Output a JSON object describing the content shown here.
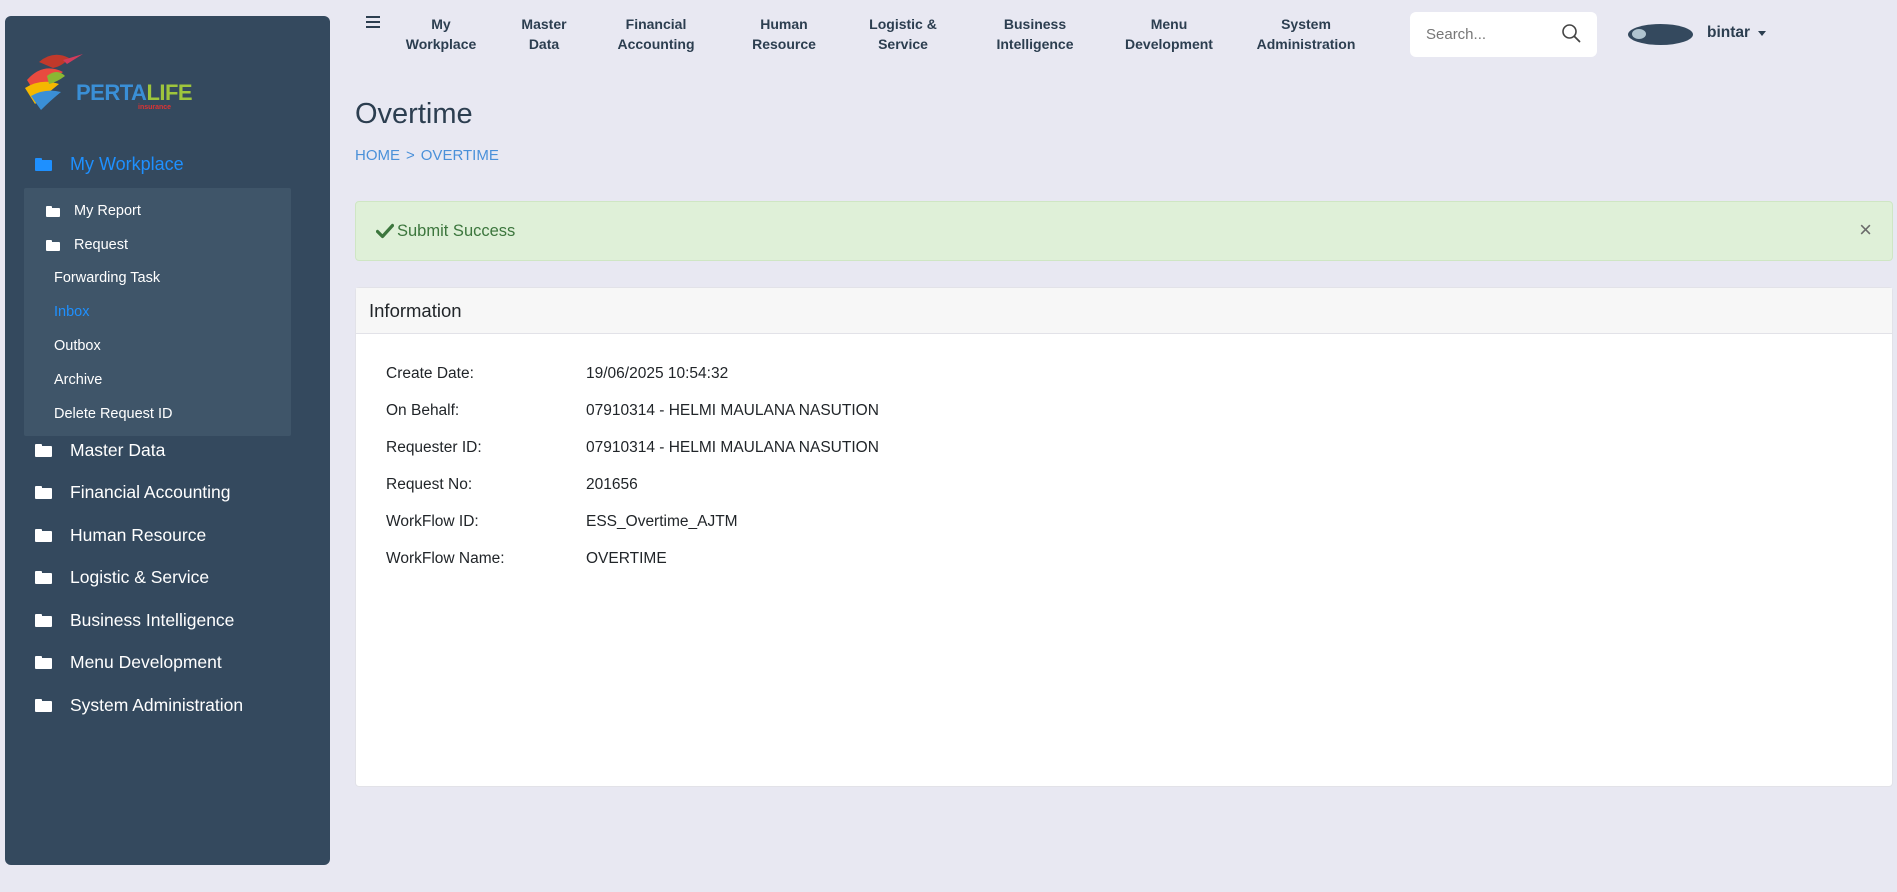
{
  "brand": {
    "logo_part1": "PERTA",
    "logo_part2": "LIFE",
    "logo_sub": "insurance"
  },
  "sidebar": {
    "top": {
      "label": "My Workplace"
    },
    "sub_folders": [
      {
        "label": "My Report"
      },
      {
        "label": "Request"
      }
    ],
    "sub_leaves": [
      {
        "label": "Forwarding Task"
      },
      {
        "label": "Inbox"
      },
      {
        "label": "Outbox"
      },
      {
        "label": "Archive"
      },
      {
        "label": "Delete Request ID"
      }
    ],
    "items": [
      {
        "label": "Master Data"
      },
      {
        "label": "Financial Accounting"
      },
      {
        "label": "Human Resource"
      },
      {
        "label": "Logistic & Service"
      },
      {
        "label": "Business Intelligence"
      },
      {
        "label": "Menu Development"
      },
      {
        "label": "System Administration"
      }
    ]
  },
  "topnav": {
    "items": [
      {
        "line1": "My",
        "line2": "Workplace"
      },
      {
        "line1": "Master",
        "line2": "Data"
      },
      {
        "line1": "Financial",
        "line2": "Accounting"
      },
      {
        "line1": "Human",
        "line2": "Resource"
      },
      {
        "line1": "Logistic &",
        "line2": "Service"
      },
      {
        "line1": "Business",
        "line2": "Intelligence"
      },
      {
        "line1": "Menu",
        "line2": "Development"
      },
      {
        "line1": "System",
        "line2": "Administration"
      }
    ],
    "search_placeholder": "Search...",
    "user": "bintar"
  },
  "page": {
    "title": "Overtime",
    "breadcrumb": [
      "HOME",
      ">",
      "OVERTIME"
    ]
  },
  "alert": {
    "message": "Submit Success",
    "close": "×"
  },
  "card": {
    "title": "Information",
    "rows": [
      {
        "label": "Create Date:",
        "value": "19/06/2025 10:54:32"
      },
      {
        "label": "On Behalf:",
        "value": "07910314 - HELMI MAULANA NASUTION"
      },
      {
        "label": "Requester ID:",
        "value": "07910314 - HELMI MAULANA NASUTION"
      },
      {
        "label": "Request No:",
        "value": "201656"
      },
      {
        "label": "WorkFlow ID:",
        "value": "ESS_Overtime_AJTM"
      },
      {
        "label": "WorkFlow Name:",
        "value": "OVERTIME"
      }
    ]
  },
  "colors": {
    "sidebar_bg": "#34495e",
    "accent": "#1e90ff",
    "success_bg": "#dff0d8",
    "success_text": "#3c763d"
  }
}
